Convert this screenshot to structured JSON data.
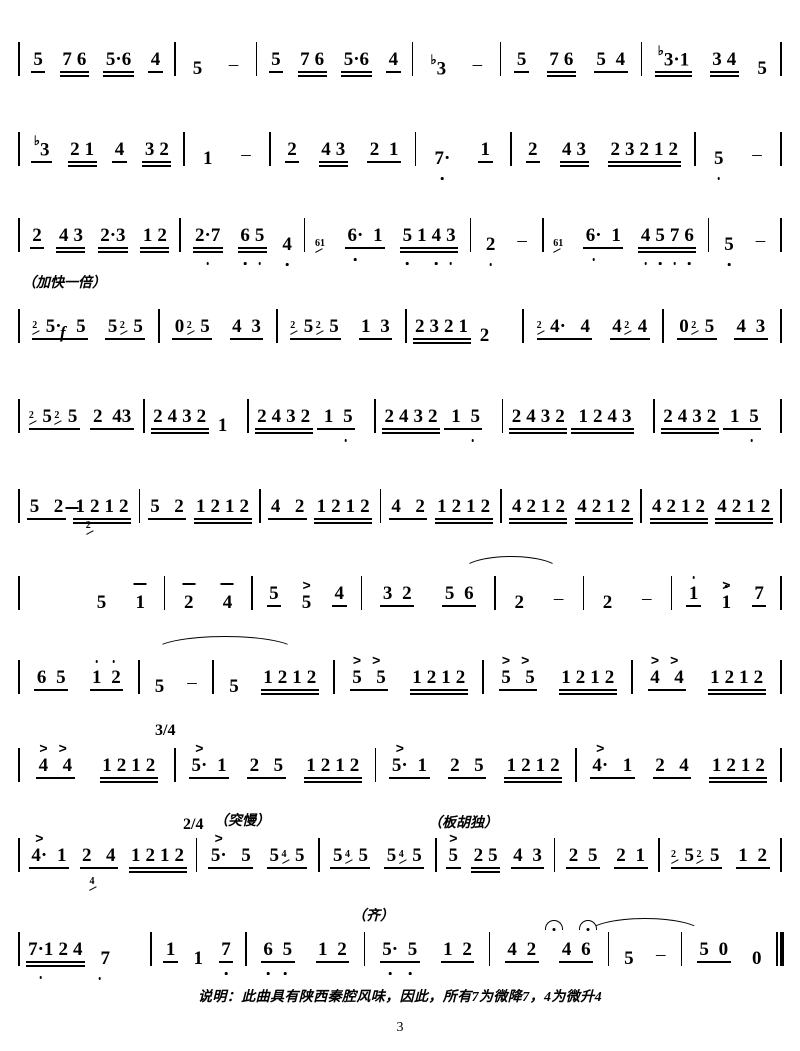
{
  "document": {
    "type": "jianpu-numbered-musical-notation",
    "page_number": "3",
    "footnote": "说明：此曲具有陕西秦腔风味，因此，所有7为微降7，4为微升4"
  },
  "annotations": {
    "faster_double": "（加快一倍）",
    "forte": "f",
    "time_3_4": "3/4",
    "time_2_4": "2/4",
    "sudden_slow": "（突慢）",
    "banhu_solo": "（板胡独）",
    "tutti": "（齐）"
  },
  "staves": [
    {
      "id": "line-1",
      "measures": [
        {
          "notes": "5 76 5·6 4"
        },
        {
          "notes": "5 -"
        },
        {
          "notes": "5 76 5·6 4"
        },
        {
          "notes": "♭3 -"
        },
        {
          "notes": "5 76 5 4"
        },
        {
          "notes": "♭3·1 34 5"
        }
      ]
    },
    {
      "id": "line-2",
      "measures": [
        {
          "notes": "♭3 21 4 32"
        },
        {
          "notes": "1 -"
        },
        {
          "notes": "2 43 2 1"
        },
        {
          "notes": "7· 1"
        },
        {
          "notes": "2 43 2321 2"
        },
        {
          "notes": "5 -"
        }
      ]
    },
    {
      "id": "line-3",
      "measures": [
        {
          "notes": "2 43 2·3 12"
        },
        {
          "notes": "2·7 65 4"
        },
        {
          "notes": "61 6· 1 5143",
          "grace": "61"
        },
        {
          "notes": "2 -"
        },
        {
          "notes": "61 6· 1 4576",
          "grace": "61"
        },
        {
          "notes": "5 -"
        }
      ]
    },
    {
      "id": "line-4",
      "measures": [
        {
          "notes": "2 5· 5 5 2 5",
          "grace": "2"
        },
        {
          "notes": "0 2 5 4 3",
          "grace": "2"
        },
        {
          "notes": "2 5 2 5 1 3",
          "grace": "2"
        },
        {
          "notes": "2321 2"
        },
        {
          "notes": "2 4· 4 4 2 4",
          "grace": "2"
        },
        {
          "notes": "0 2 5 4 3",
          "grace": "2"
        }
      ]
    },
    {
      "id": "line-5",
      "measures": [
        {
          "notes": "2 5 2 5 2 43",
          "grace": "2"
        },
        {
          "notes": "2432 1"
        },
        {
          "notes": "2432 1 5"
        },
        {
          "notes": "2432 1 5"
        },
        {
          "notes": "2432 1243"
        },
        {
          "notes": "2432 1 5"
        }
      ]
    },
    {
      "id": "line-6",
      "measures": [
        {
          "notes": "5 2 1212"
        },
        {
          "notes": "5 2 1212"
        },
        {
          "notes": "4 2 1212"
        },
        {
          "notes": "4 2 1212"
        },
        {
          "notes": "4212 4212"
        },
        {
          "notes": "4212 4212"
        }
      ]
    },
    {
      "id": "line-7",
      "measures": [
        {
          "notes": "2 5 1",
          "grace": "2"
        },
        {
          "notes": "2 4"
        },
        {
          "notes": "5 5 4"
        },
        {
          "notes": "3 2 5 6"
        },
        {
          "notes": "2 -"
        },
        {
          "notes": "2 -"
        },
        {
          "notes": "1 1 7"
        }
      ]
    },
    {
      "id": "line-8",
      "measures": [
        {
          "notes": "6 5 1 2"
        },
        {
          "notes": "5 -"
        },
        {
          "notes": "5 1212"
        },
        {
          "notes": "5 5 1212"
        },
        {
          "notes": "5 5 1212"
        },
        {
          "notes": "4 4 1212"
        }
      ]
    },
    {
      "id": "line-9",
      "measures": [
        {
          "notes": "4 4 1212"
        },
        {
          "notes": "5·1 2 5 1212"
        },
        {
          "notes": "5· 1 2 5 1212"
        },
        {
          "notes": "4· 1 2 4 1212"
        }
      ]
    },
    {
      "id": "line-10",
      "measures": [
        {
          "notes": "4·1 2 4 1212"
        },
        {
          "notes": "5· 5 5 4 5",
          "grace": "4"
        },
        {
          "notes": "5 4 5 5 4 5",
          "grace": "4"
        },
        {
          "notes": "5 25 4 3"
        },
        {
          "notes": "2 5 2 1"
        },
        {
          "notes": "2 5 2 5 1 2",
          "grace": "2"
        }
      ]
    },
    {
      "id": "line-11",
      "measures": [
        {
          "notes": "7·124 4 7",
          "grace": "4"
        },
        {
          "notes": "1 1 7"
        },
        {
          "notes": "6 5 1 2"
        },
        {
          "notes": "5· 5 1 2"
        },
        {
          "notes": "4 2 4 6"
        },
        {
          "notes": "5 -"
        },
        {
          "notes": "5 0 0"
        }
      ]
    }
  ]
}
